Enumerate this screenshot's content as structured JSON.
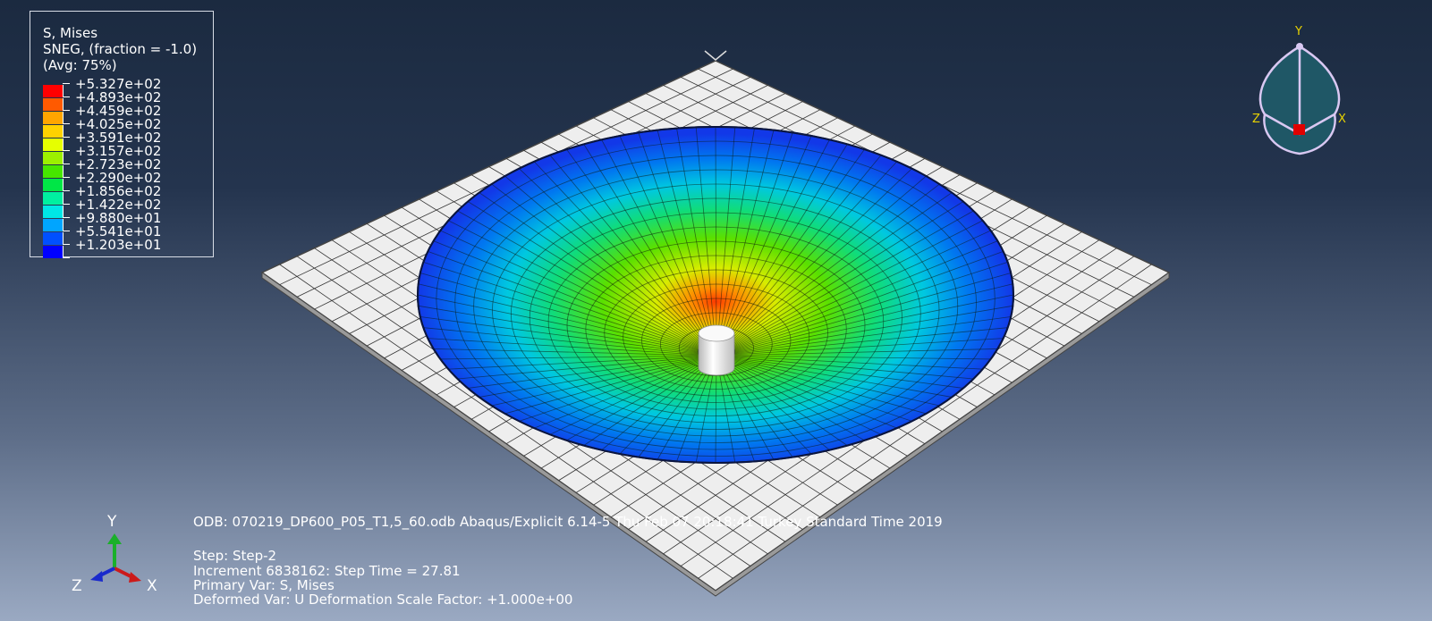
{
  "legend": {
    "title": "S, Mises",
    "subtitle": "SNEG, (fraction = -1.0)",
    "avg": "(Avg: 75%)",
    "entries": [
      {
        "value": "+5.327e+02",
        "color": "#ff0000"
      },
      {
        "value": "+4.893e+02",
        "color": "#ff5a00"
      },
      {
        "value": "+4.459e+02",
        "color": "#ffa500"
      },
      {
        "value": "+4.025e+02",
        "color": "#ffd200"
      },
      {
        "value": "+3.591e+02",
        "color": "#e6ff00"
      },
      {
        "value": "+3.157e+02",
        "color": "#9cf000"
      },
      {
        "value": "+2.723e+02",
        "color": "#46e600"
      },
      {
        "value": "+2.290e+02",
        "color": "#00e646"
      },
      {
        "value": "+1.856e+02",
        "color": "#00f0a0"
      },
      {
        "value": "+1.422e+02",
        "color": "#00e6e6"
      },
      {
        "value": "+9.880e+01",
        "color": "#00a5ff"
      },
      {
        "value": "+5.541e+01",
        "color": "#0050ff"
      },
      {
        "value": "+1.203e+01",
        "color": "#0000ff"
      }
    ]
  },
  "info": {
    "odb": "ODB: 070219_DP600_P05_T1,5_60.odb    Abaqus/Explicit 6.14-5    Thu Feb 07 20:18:41 Turkey Standard Time 2019",
    "step": "Step: Step-2",
    "increment": "Increment   6838162: Step Time =    27.81",
    "primary_var": "Primary Var: S, Mises",
    "deformed_var": "Deformed Var: U   Deformation Scale Factor: +1.000e+00"
  },
  "triad": {
    "y": "Y",
    "z": "Z",
    "x": "X"
  },
  "view_cube": {
    "y": "Y",
    "z": "Z",
    "x": "X"
  },
  "colors": {
    "sheet": "#eeeeee",
    "mesh_line": "#222222",
    "triad_x": "#cc1a1a",
    "triad_y": "#1ab02a",
    "triad_z": "#1a2acc",
    "view_cube": "#1f5766",
    "view_cube_edge": "#d9c8f2"
  }
}
